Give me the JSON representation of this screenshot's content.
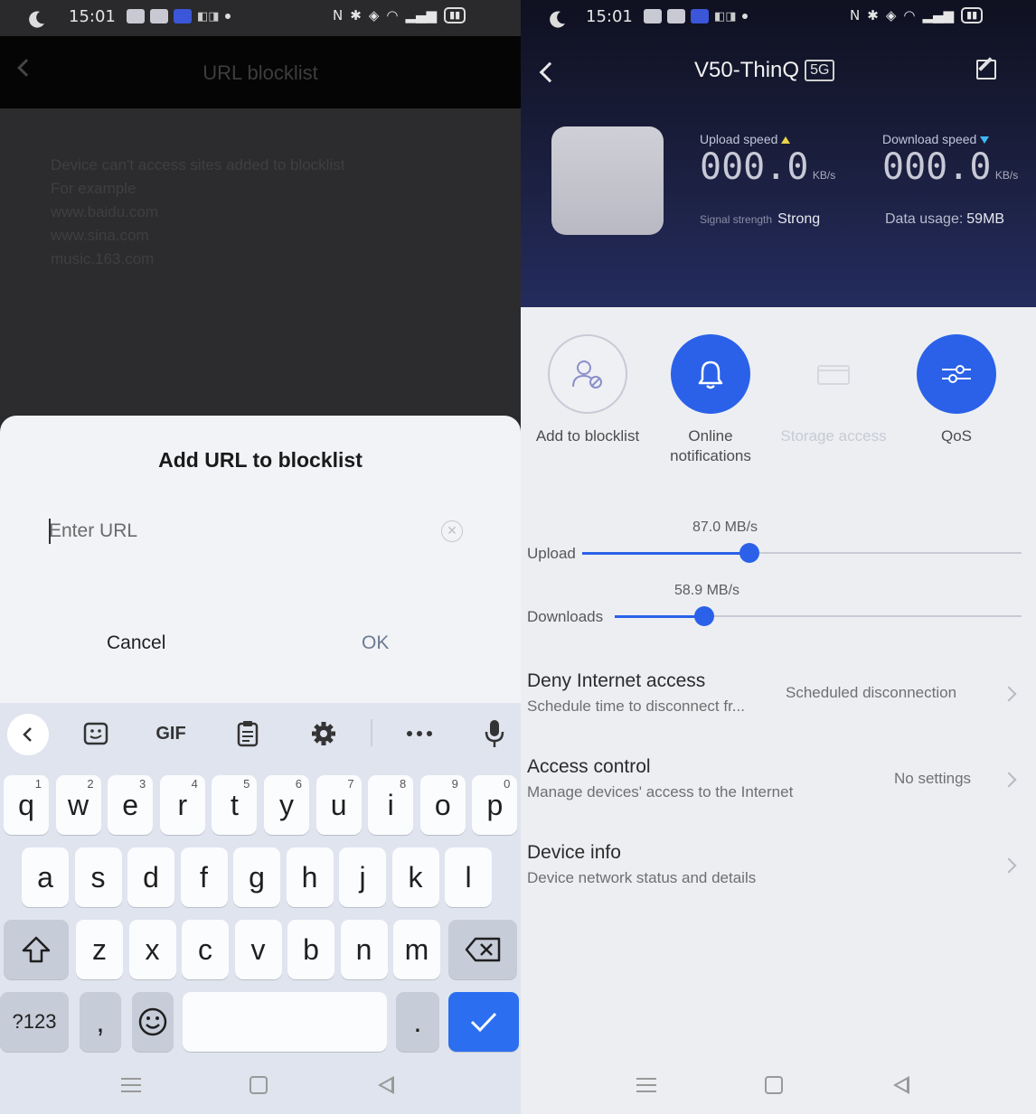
{
  "left": {
    "status": {
      "time": "15:01"
    },
    "header": {
      "title": "URL blocklist"
    },
    "hint": "Device can't access sites added to blocklist\nFor example\nwww.baidu.com\nwww.sina.com\nmusic.163.com",
    "dialog": {
      "title": "Add URL to blocklist",
      "placeholder": "Enter URL",
      "value": "",
      "cancel": "Cancel",
      "ok": "OK"
    },
    "keyboard": {
      "toolbar": {
        "gif": "GIF"
      },
      "row1": [
        {
          "k": "q",
          "n": "1"
        },
        {
          "k": "w",
          "n": "2"
        },
        {
          "k": "e",
          "n": "3"
        },
        {
          "k": "r",
          "n": "4"
        },
        {
          "k": "t",
          "n": "5"
        },
        {
          "k": "y",
          "n": "6"
        },
        {
          "k": "u",
          "n": "7"
        },
        {
          "k": "i",
          "n": "8"
        },
        {
          "k": "o",
          "n": "9"
        },
        {
          "k": "p",
          "n": "0"
        }
      ],
      "row2": [
        "a",
        "s",
        "d",
        "f",
        "g",
        "h",
        "j",
        "k",
        "l"
      ],
      "row3": [
        "z",
        "x",
        "c",
        "v",
        "b",
        "n",
        "m"
      ],
      "symbols": "?123",
      "comma": ",",
      "period": "."
    }
  },
  "right": {
    "status": {
      "time": "15:01"
    },
    "device_name": "V50-ThinQ",
    "badge": "5G",
    "upload": {
      "label": "Upload speed",
      "value": "000.0",
      "unit": "KB/s"
    },
    "download": {
      "label": "Download speed",
      "value": "000.0",
      "unit": "KB/s"
    },
    "signal": {
      "label": "Signal strength",
      "value": "Strong"
    },
    "data_usage": {
      "label": "Data usage:",
      "value": "59MB"
    },
    "actions": [
      {
        "label": "Add to blocklist",
        "icon": "user-block-icon",
        "enabled": true
      },
      {
        "label": "Online notifications",
        "icon": "bell-icon",
        "enabled": true
      },
      {
        "label": "Storage access",
        "icon": "folder-icon",
        "enabled": false
      },
      {
        "label": "QoS",
        "icon": "sliders-icon",
        "enabled": true
      }
    ],
    "qos": {
      "upload": {
        "label": "Upload",
        "value": "87.0 MB/s",
        "fraction": 0.38
      },
      "download": {
        "label": "Downloads",
        "value": "58.9 MB/s",
        "fraction": 0.22
      }
    },
    "rows": [
      {
        "title": "Deny Internet access",
        "subtitle": "Schedule time to disconnect fr...",
        "value": "Scheduled disconnection"
      },
      {
        "title": "Access control",
        "subtitle": "Manage devices' access to the Internet",
        "value": "No settings"
      },
      {
        "title": "Device info",
        "subtitle": "Device network status and details",
        "value": ""
      }
    ],
    "colors": {
      "accent": "#2a61e8",
      "header_bg": "#1a1e3c"
    }
  }
}
